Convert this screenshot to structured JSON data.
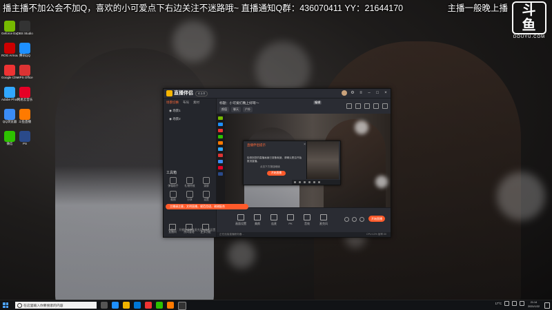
{
  "overlay": {
    "banner": "播主播不加公会不加Q，喜欢的小可爱点下右边关注不迷路哦~ 直播通知Q群：436070411  YY：21644170",
    "corner_text": "主播一般晚上播",
    "logo_mark": "斗鱼",
    "logo_sub": "DOUYU.COM"
  },
  "desktop_icons": [
    {
      "label": "Geforce Experience",
      "color": "#76b900"
    },
    {
      "label": "OBS Studio",
      "color": "#333"
    },
    {
      "label": "ROG Armoury",
      "color": "#c00"
    },
    {
      "label": "腾讯QQ",
      "color": "#1e90ff"
    },
    {
      "label": "Google Chrome",
      "color": "#e33"
    },
    {
      "label": "WPS Office",
      "color": "#d33"
    },
    {
      "label": "Adobe Photoshop",
      "color": "#31a8ff"
    },
    {
      "label": "网易云音乐",
      "color": "#e60026"
    },
    {
      "label": "QQ浏览器",
      "color": "#3b8cf5"
    },
    {
      "label": "斗鱼直播",
      "color": "#ff7a00"
    },
    {
      "label": "微信",
      "color": "#2dc100"
    },
    {
      "label": "PS",
      "color": "#2a4a8a"
    }
  ],
  "app": {
    "title": "直播伴侣",
    "version": "4.1.0",
    "left_tabs": [
      "场景切换",
      "布局",
      "素材"
    ],
    "scenes": [
      "场景1",
      "场景2"
    ],
    "tools_title": "工具箱",
    "tools": [
      "弹幕助手",
      "礼物特效",
      "录屏",
      "截图",
      "分享",
      "设置"
    ],
    "bottom_tools": [
      "直播间",
      "房间管理",
      "更多功能"
    ],
    "stream_title": "标题：小可爱们晚上好呀～",
    "edit_label": "编辑",
    "tags": [
      "颜值",
      "聊天",
      "户外"
    ],
    "toolbar_items": [
      "画面设置",
      "美颜",
      "连麦",
      "PK",
      "音效",
      "麦克风"
    ],
    "start_label": "开始直播",
    "status_left": "正在连接直播服务器…",
    "status_right": "CPU:12%  帧率:30",
    "footer_note": "小贴士：开播前请检查麦克风与画面设置",
    "toast": "主播请注意，文明直播，规范用语，谢谢配合"
  },
  "dialog": {
    "title": "直播伴侣提示",
    "close": "×",
    "body": "检测到您的直播画面已准备就绪，请确认是否开始推流直播。",
    "sub": "点击下方按钮继续",
    "button": "开始直播"
  },
  "taskbar": {
    "search_placeholder": "在这里输入你要搜索的内容",
    "weather": "17°C",
    "time": "21:14",
    "date": "2021/1/22"
  }
}
